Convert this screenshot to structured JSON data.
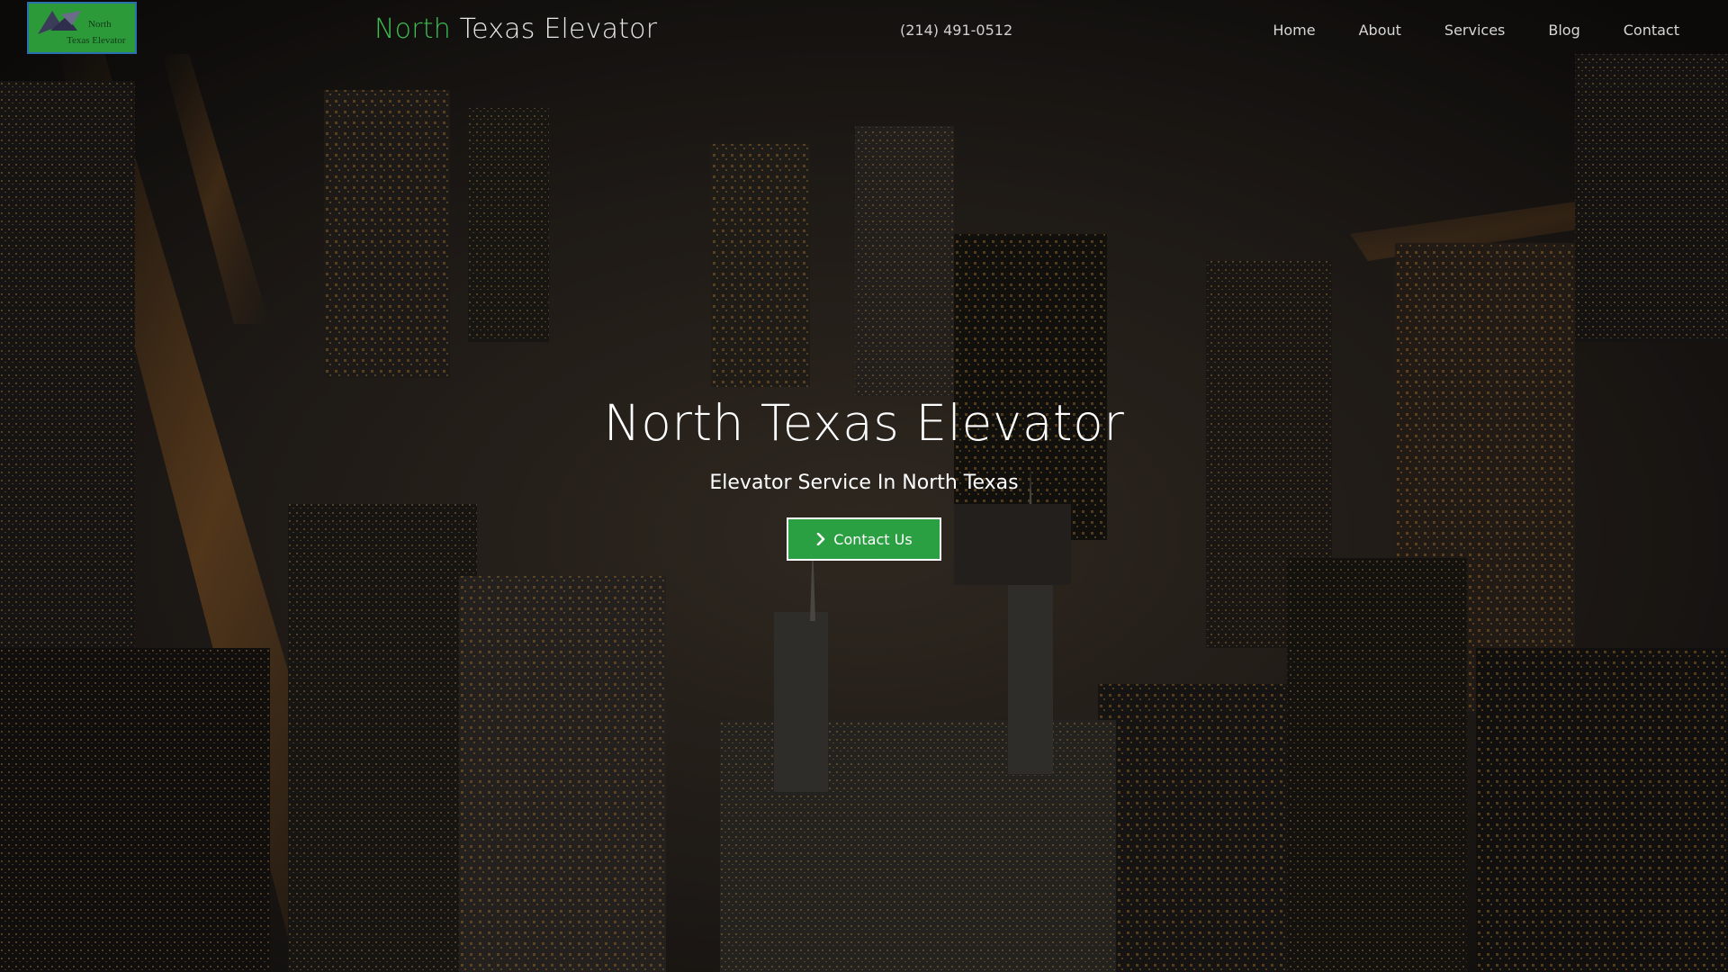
{
  "logo": {
    "line1": "North",
    "line2": "Texas Elevator",
    "background": "#2d9a3a",
    "border": "#2a6fb0"
  },
  "brand": {
    "accent_word": "North",
    "rest": "Texas Elevator",
    "accent_color": "#3dbd4f"
  },
  "header": {
    "phone": "(214) 491-0512"
  },
  "nav": {
    "items": [
      {
        "label": "Home"
      },
      {
        "label": "About"
      },
      {
        "label": "Services"
      },
      {
        "label": "Blog"
      },
      {
        "label": "Contact"
      }
    ]
  },
  "hero": {
    "title": "North Texas Elevator",
    "subtitle": "Elevator Service In North Texas",
    "cta_label": "Contact Us",
    "cta_icon": "chevron-right-icon",
    "cta_color": "#2aa043",
    "background": "aerial-city-at-night"
  }
}
